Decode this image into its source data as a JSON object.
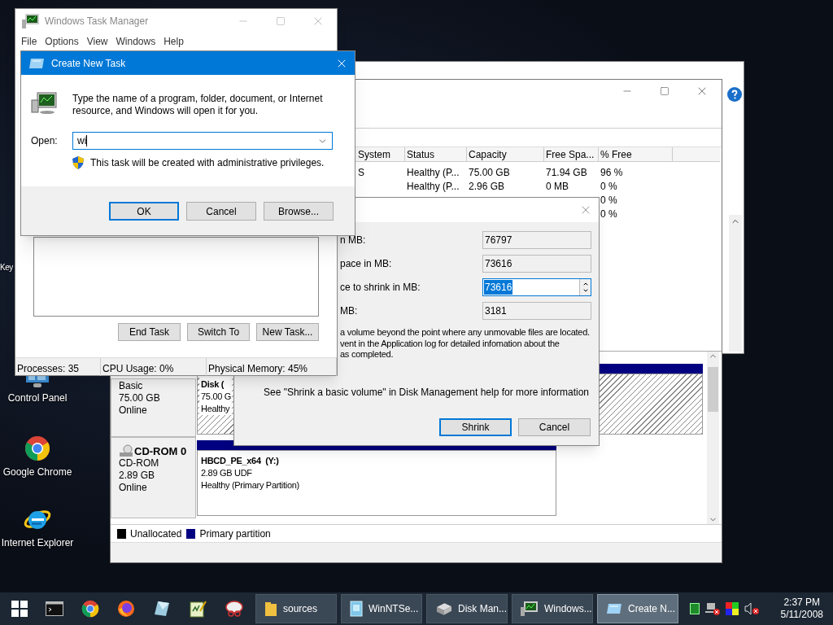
{
  "desktop_icons": [
    {
      "label": "Key",
      "kind": "hidden"
    },
    {
      "label": "Control Panel",
      "kind": "control-panel"
    },
    {
      "label": "Google Chrome",
      "kind": "chrome"
    },
    {
      "label": "Internet Explorer",
      "kind": "ie"
    }
  ],
  "disk_management": {
    "volume_list": {
      "columns": [
        "System",
        "Status",
        "Capacity",
        "Free Spa...",
        "% Free"
      ],
      "rows": [
        {
          "file_system": "S",
          "status": "Healthy (P...",
          "capacity": "75.00 GB",
          "free_space": "71.94 GB",
          "percent_free": "96 %"
        },
        {
          "status": "Healthy (P...",
          "capacity": "2.96 GB",
          "free_space": "0 MB",
          "percent_free": "0 %"
        },
        {
          "percent_free": "0 %"
        },
        {
          "percent_free": "0 %"
        }
      ]
    },
    "disks": [
      {
        "kind": "hdd",
        "type": "Basic",
        "size": "75.00 GB",
        "status": "Online",
        "partition": {
          "name": "Disk (",
          "size": "75.00 G",
          "status": "Healthy",
          "selected": true
        }
      },
      {
        "kind": "cdrom",
        "name": "CD-ROM 0",
        "type": "CD-ROM",
        "size": "2.89 GB",
        "status": "Online",
        "partition": {
          "name": "HBCD_PE_x64  (Y:)",
          "size": "2.89 GB UDF",
          "status": "Healthy (Primary Partition)",
          "selected": false
        }
      }
    ],
    "legend": [
      {
        "label": "Unallocated",
        "color": "#000000"
      },
      {
        "label": "Primary partition",
        "color": "#000080"
      }
    ]
  },
  "shrink_dialog": {
    "fields": [
      {
        "label": "n MB:",
        "value": "76797",
        "editable": false,
        "selected": false
      },
      {
        "label": "pace in MB:",
        "value": "73616",
        "editable": false,
        "selected": false
      },
      {
        "label": "ce to shrink in MB:",
        "value": "73616",
        "editable": true,
        "selected": true
      },
      {
        "label": "MB:",
        "value": "3181",
        "editable": false,
        "selected": false
      }
    ],
    "message": "a volume beyond the point where any unmovable files are located.\nvent in the Application log for detailed infomation about the\nas completed.",
    "help_text": "See \"Shrink a basic volume\" in Disk Management help for more information",
    "buttons": [
      {
        "label": "Shrink",
        "default": true
      },
      {
        "label": "Cancel",
        "default": false
      }
    ]
  },
  "task_manager": {
    "title": "Windows Task Manager",
    "menu": [
      "File",
      "Options",
      "View",
      "Windows",
      "Help"
    ],
    "buttons": [
      "End Task",
      "Switch To",
      "New Task..."
    ],
    "status_bar": [
      "Processes: 35",
      "CPU Usage: 0%",
      "Physical Memory: 45%"
    ]
  },
  "create_task": {
    "title": "Create New Task",
    "prompt": "Type the name of a program, folder, document, or Internet resource, and Windows will open it for you.",
    "open_label": "Open:",
    "open_value": "wi",
    "note": "This task will be created with administrative privileges.",
    "buttons": [
      {
        "label": "OK",
        "default": true
      },
      {
        "label": "Cancel",
        "default": false
      },
      {
        "label": "Browse...",
        "default": false
      }
    ]
  },
  "taskbar": {
    "pinned": [
      {
        "kind": "start"
      },
      {
        "kind": "cmd"
      },
      {
        "kind": "chrome"
      },
      {
        "kind": "firefox"
      },
      {
        "kind": "glass"
      },
      {
        "kind": "notepad"
      },
      {
        "kind": "snip"
      }
    ],
    "windows": [
      {
        "label": "sources",
        "kind": "folder",
        "active": false
      },
      {
        "label": "WinNTSe...",
        "kind": "setup",
        "active": false
      },
      {
        "label": "Disk Man...",
        "kind": "disk",
        "active": false
      },
      {
        "label": "Windows...",
        "kind": "taskmgr",
        "active": false
      },
      {
        "label": "Create N...",
        "kind": "run",
        "active": true
      }
    ],
    "tray": [
      {
        "kind": "chip"
      },
      {
        "kind": "network"
      },
      {
        "kind": "display"
      },
      {
        "kind": "volume-muted"
      }
    ],
    "time": "2:37 PM",
    "date": "5/11/2008"
  }
}
